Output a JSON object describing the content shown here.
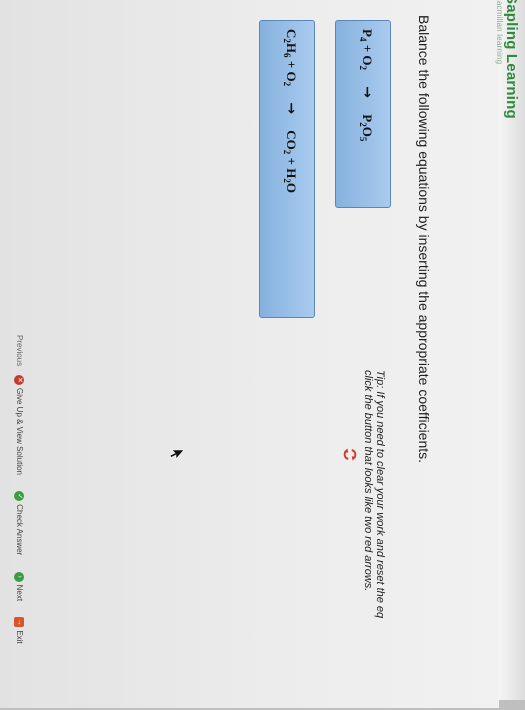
{
  "brand": {
    "name": "Sapling Learning",
    "subtitle": "macmillan learning"
  },
  "instruction": "Balance the following equations by inserting the appropriate coefficients.",
  "equation1": {
    "lhs_a": "P",
    "lhs_a_sub": "4",
    "plus": "+",
    "lhs_b": "O",
    "lhs_b_sub": "2",
    "arrow": "→",
    "rhs_p": "P",
    "rhs_p_sub": "2",
    "rhs_o": "O",
    "rhs_o_sub": "5"
  },
  "equation2": {
    "lhs_c": "C",
    "lhs_c_sub": "2",
    "lhs_h": "H",
    "lhs_h_sub": "6",
    "plus": "+",
    "lhs_o": "O",
    "lhs_o_sub": "2",
    "arrow": "→",
    "rhs_co": "CO",
    "rhs_co_sub": "2",
    "plus2": "+",
    "rhs_h": "H",
    "rhs_h_sub": "2",
    "rhs_o": "O"
  },
  "tip": {
    "line1": "Tip: If you need to clear your work and reset the eq",
    "line2": "click the button that looks like two red arrows."
  },
  "toolbar": {
    "previous": "Previous",
    "give_up": "Give Up & View Solution",
    "check": "Check Answer",
    "next": "Next",
    "exit": "Exit"
  },
  "colors": {
    "brand_green": "#2e8b3a",
    "equation_box": "#97bde6",
    "give_up_icon": "#c53a2c",
    "check_icon": "#3d9c3f"
  },
  "icons": [
    "reset-arrows-icon",
    "cursor-icon",
    "give-up-icon",
    "check-icon",
    "next-icon",
    "exit-icon"
  ]
}
